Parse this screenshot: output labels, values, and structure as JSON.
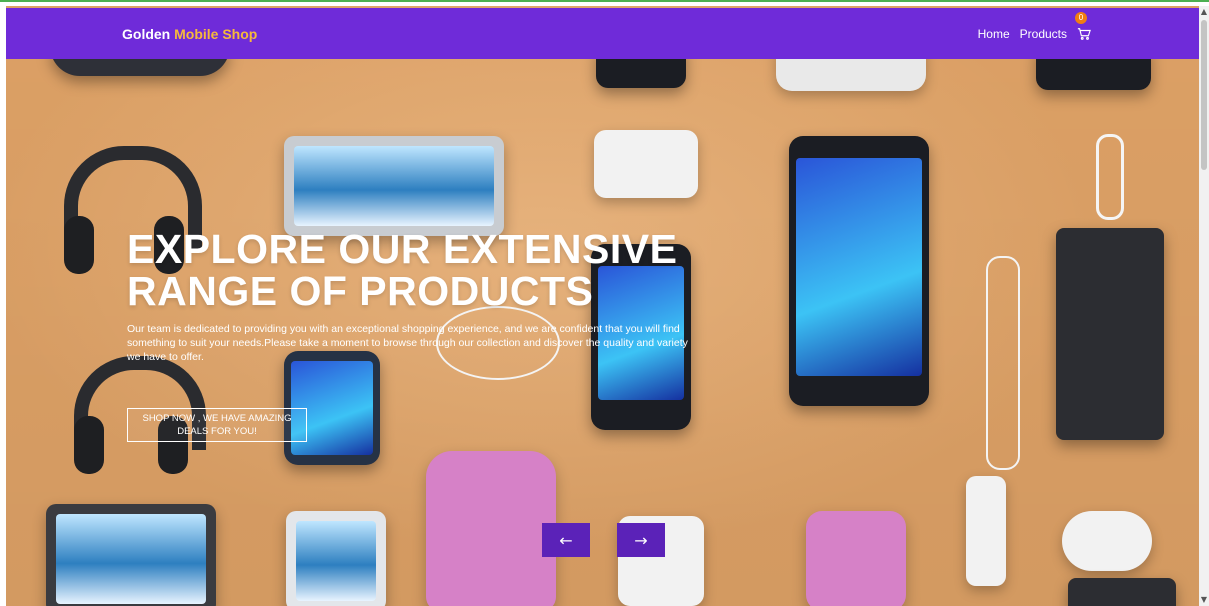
{
  "navbar": {
    "brand_primary": "Golden",
    "brand_accent": "Mobile Shop",
    "links": [
      "Home",
      "Products"
    ],
    "cart_count": "0",
    "cart_icon": "cart-icon"
  },
  "hero": {
    "headline": "EXPLORE OUR EXTENSIVE RANGE OF PRODUCTS",
    "description": "Our team is dedicated to providing you with an exceptional shopping experience, and we are confident that you will find something to suit your needs.Please take a moment to browse through our collection and discover the quality and variety we have to offer.",
    "cta_label": "SHOP NOW , WE HAVE AMAZING DEALS FOR YOU!"
  },
  "carousel": {
    "prev_label": "←",
    "next_label": "→"
  },
  "colors": {
    "navbar_bg": "#6f2bd9",
    "brand_accent": "#f6b93b",
    "hero_bg": "#e0a367",
    "arrow_bg": "#5b22b8",
    "badge_bg": "#f07d12"
  }
}
